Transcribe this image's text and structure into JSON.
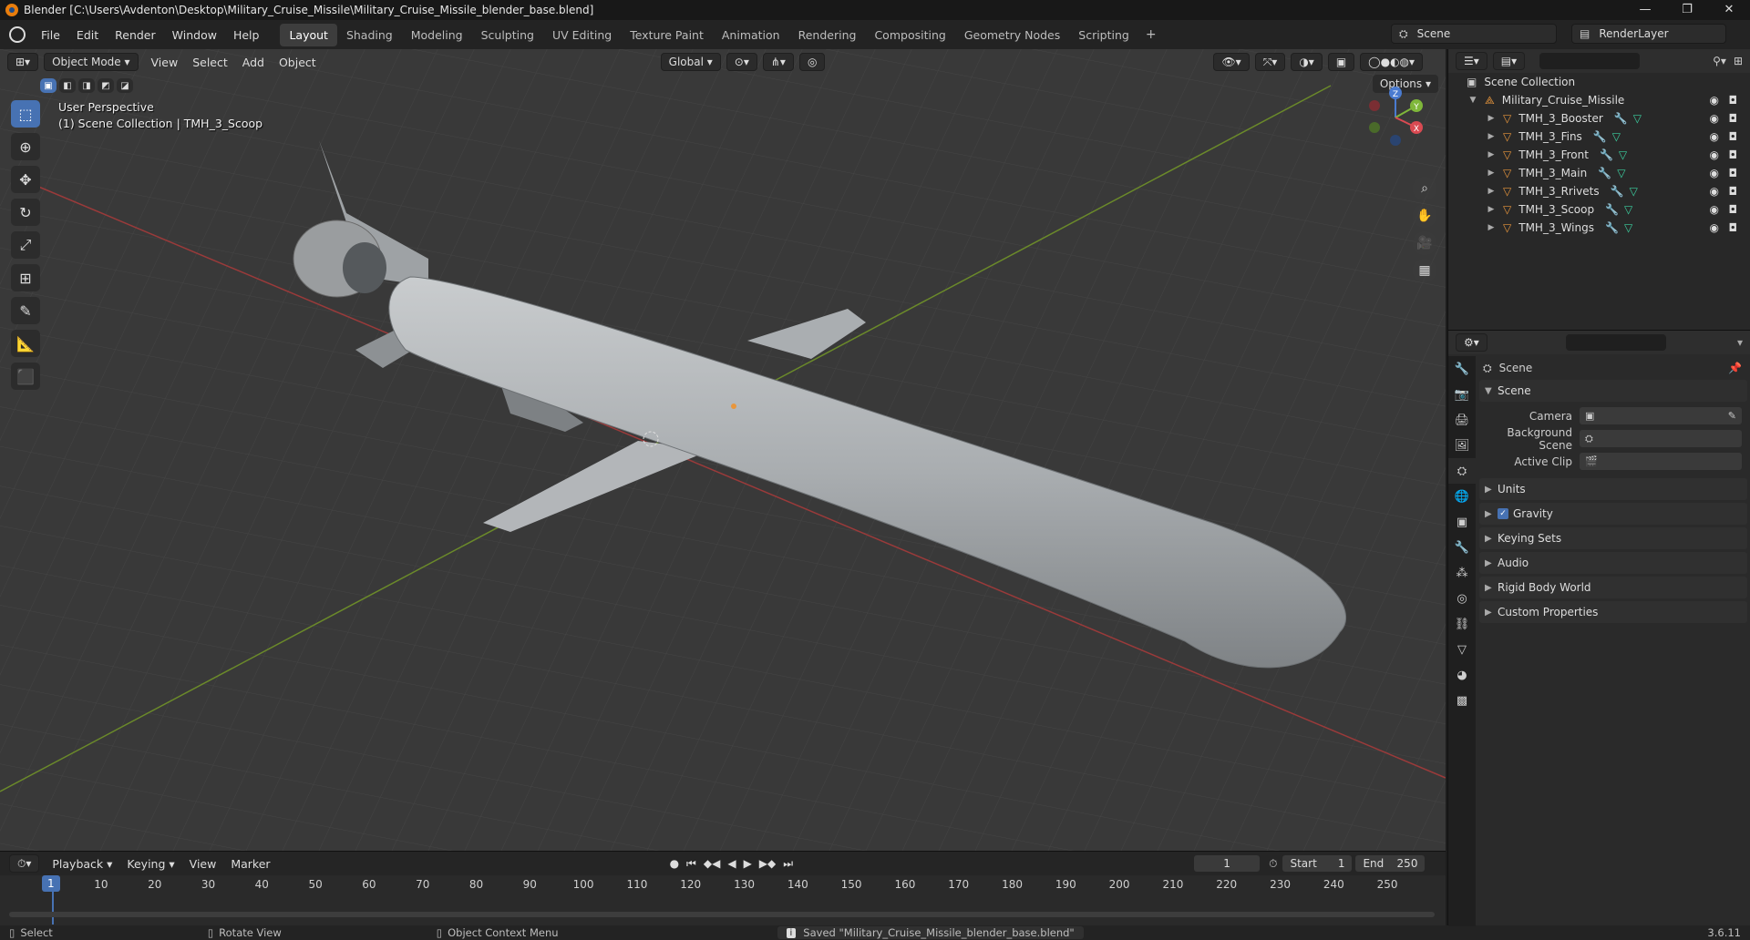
{
  "window": {
    "title": "Blender [C:\\Users\\Avdenton\\Desktop\\Military_Cruise_Missile\\Military_Cruise_Missile_blender_base.blend]",
    "min": "—",
    "max": "❐",
    "close": "✕"
  },
  "menu": [
    "File",
    "Edit",
    "Render",
    "Window",
    "Help"
  ],
  "workspaces": [
    "Layout",
    "Shading",
    "Modeling",
    "Sculpting",
    "UV Editing",
    "Texture Paint",
    "Animation",
    "Rendering",
    "Compositing",
    "Geometry Nodes",
    "Scripting"
  ],
  "workspace_add": "+",
  "scene_selector": "Scene",
  "render_layer": "RenderLayer",
  "viewport": {
    "mode": "Object Mode",
    "menus": [
      "View",
      "Select",
      "Add",
      "Object"
    ],
    "orientation": "Global",
    "options": "Options",
    "overlay_line1": "User Perspective",
    "overlay_line2": "(1) Scene Collection | TMH_3_Scoop",
    "axis_x": "X",
    "axis_y": "Y",
    "axis_z": "Z"
  },
  "outliner": {
    "root": "Scene Collection",
    "collection": "Military_Cruise_Missile",
    "objects": [
      "TMH_3_Booster",
      "TMH_3_Fins",
      "TMH_3_Front",
      "TMH_3_Main",
      "TMH_3_Rrivets",
      "TMH_3_Scoop",
      "TMH_3_Wings"
    ]
  },
  "properties": {
    "context": "Scene",
    "panel": "Scene",
    "camera_label": "Camera",
    "bg_scene_label": "Background Scene",
    "active_clip_label": "Active Clip",
    "subpanels": [
      "Units",
      "Gravity",
      "Keying Sets",
      "Audio",
      "Rigid Body World",
      "Custom Properties"
    ]
  },
  "timeline": {
    "menus": [
      "Playback",
      "Keying",
      "View",
      "Marker"
    ],
    "current_frame": "1",
    "start_label": "Start",
    "start": "1",
    "end_label": "End",
    "end": "250",
    "ticks": [
      "10",
      "20",
      "30",
      "40",
      "50",
      "60",
      "70",
      "80",
      "90",
      "100",
      "110",
      "120",
      "130",
      "140",
      "150",
      "160",
      "170",
      "180",
      "190",
      "200",
      "210",
      "220",
      "230",
      "240",
      "250"
    ]
  },
  "status": {
    "select": "Select",
    "rotate": "Rotate View",
    "context_menu": "Object Context Menu",
    "message": "Saved \"Military_Cruise_Missile_blender_base.blend\"",
    "version": "3.6.11"
  },
  "colors": {
    "accent": "#4772b3",
    "grid_bg": "#3a3a3a",
    "object_orange": "#e8963c"
  }
}
